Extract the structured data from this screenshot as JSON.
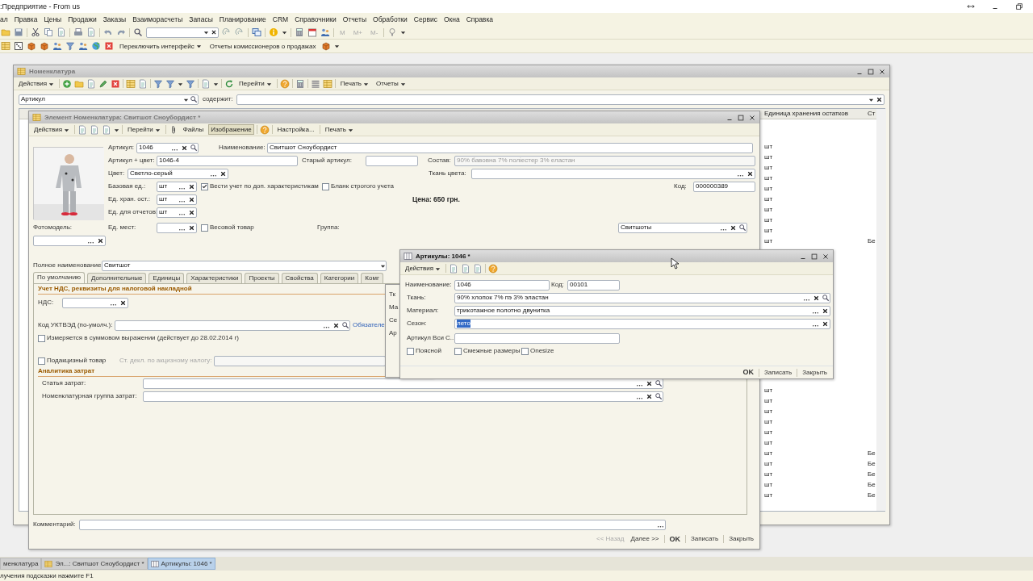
{
  "app": {
    "title": ":Предприятие - From us",
    "menu": [
      "ал",
      "Правка",
      "Цены",
      "Продажи",
      "Заказы",
      "Взаиморасчеты",
      "Запасы",
      "Планирование",
      "CRM",
      "Справочники",
      "Отчеты",
      "Обработки",
      "Сервис",
      "Окна",
      "Справка"
    ],
    "memory_buttons": [
      {
        "label": "M",
        "disabled": true
      },
      {
        "label": "M+",
        "disabled": true
      },
      {
        "label": "M-",
        "disabled": true
      }
    ],
    "toolbar2": [
      {
        "label": "Переключить интерфейс",
        "dropdown": true
      },
      {
        "label": "Отчеты комиссионеров о продажах",
        "dropdown": false
      }
    ]
  },
  "list_window": {
    "title": "Номенклатура",
    "active": false,
    "toolbar": [
      {
        "label": "Действия",
        "dropdown": true
      },
      {
        "label": "Перейти",
        "dropdown": true
      },
      {
        "label": "Печать",
        "dropdown": true
      },
      {
        "label": "Отчеты",
        "dropdown": true
      }
    ],
    "filter_field": {
      "value": "Артикул"
    },
    "filter_label": "содержит:",
    "columns": [
      "Единица хранения остатков",
      "Ст"
    ],
    "rows_top": [
      {
        "unit": "шт"
      },
      {
        "unit": "шт"
      },
      {
        "unit": "шт"
      },
      {
        "unit": "шт"
      },
      {
        "unit": "шт"
      },
      {
        "unit": "шт"
      },
      {
        "unit": "шт"
      },
      {
        "unit": "шт"
      },
      {
        "unit": "шт"
      },
      {
        "unit": "шт",
        "column_2": "Бе"
      }
    ],
    "rows_bottom": [
      {
        "unit": "шт"
      },
      {
        "unit": "шт"
      },
      {
        "unit": "шт"
      },
      {
        "unit": "шт"
      },
      {
        "unit": "шт"
      },
      {
        "unit": "шт"
      },
      {
        "unit": "шт",
        "column_2": "Бе"
      },
      {
        "unit": "шт",
        "column_2": "Бе"
      },
      {
        "unit": "шт",
        "column_2": "Бе"
      },
      {
        "unit": "шт",
        "column_2": "Бе"
      },
      {
        "unit": "шт",
        "column_2": "Бе"
      }
    ]
  },
  "element_window": {
    "title": "Элемент Номенклатура: Свитшот Сноубордист *",
    "active": false,
    "toolbar": [
      {
        "label": "Действия",
        "dropdown": true,
        "pressed": false
      },
      {
        "label": "Перейти",
        "dropdown": true,
        "pressed": false
      },
      {
        "label": "Файлы",
        "dropdown": false,
        "pressed": false
      },
      {
        "label": "Изображение",
        "dropdown": false,
        "pressed": true
      },
      {
        "label": "Настройка...",
        "dropdown": false,
        "pressed": false
      },
      {
        "label": "Печать",
        "dropdown": true,
        "pressed": false
      }
    ],
    "articul": {
      "label": "Артикул:",
      "value": "1046"
    },
    "name": {
      "label": "Наименование:",
      "value": "Свитшот Сноубордист"
    },
    "articul_color": {
      "label": "Артикул + цвет:",
      "value": "1046-4"
    },
    "old_articul": {
      "label": "Старый артикул:"
    },
    "composition": {
      "label": "Состав:",
      "value": "90% бавовна 7% поліестер 3% еластан",
      "disabled": true
    },
    "color": {
      "label": "Цвет:",
      "value": "Светло-серый"
    },
    "fabric_color": {
      "label": "Ткань цвета:"
    },
    "base_unit": {
      "label": "Базовая ед.:",
      "value": "шт"
    },
    "track_characteristics": {
      "label": "Вести учет по доп. характеристикам",
      "checked": true
    },
    "strict_form": {
      "label": "Бланк строгого учета",
      "checked": false
    },
    "code": {
      "label": "Код:",
      "value": "000000389"
    },
    "storage_unit": {
      "label": "Ед. хран. ост.:",
      "value": "шт"
    },
    "price": "Цена: 650 грн.",
    "report_unit": {
      "label": "Ед. для отчетов:",
      "value": "шт"
    },
    "photo_model": {
      "label": "Фотомодель:"
    },
    "place_unit": {
      "label": "Ед. мест:"
    },
    "weight_goods": {
      "label": "Весовой товар",
      "checked": false
    },
    "group": {
      "label": "Группа:",
      "value": "Свитшоты"
    },
    "full_name": {
      "label": "Полное наименование:",
      "value": "Свитшот"
    },
    "tabs": [
      {
        "label": "По умолчанию",
        "selected": true
      },
      {
        "label": "Дополнительные",
        "selected": false
      },
      {
        "label": "Единицы",
        "selected": false
      },
      {
        "label": "Характеристики",
        "selected": false
      },
      {
        "label": "Проекты",
        "selected": false
      },
      {
        "label": "Свойства",
        "selected": false
      },
      {
        "label": "Категории",
        "selected": false
      },
      {
        "label": "Комг",
        "selected": false
      }
    ],
    "vat_section": "Учет НДС, реквизиты для налоговой накладной",
    "vat": {
      "label": "НДС:"
    },
    "uktzed": {
      "label": "Код УКТВЭД (по-умолч.):",
      "link": "Обязателе"
    },
    "sum_measure": {
      "label": "Измеряется в суммовом выражении (действует до 28.02.2014 г)",
      "checked": false
    },
    "excise": {
      "label": "Подакцизный товар",
      "checked": false
    },
    "excise_declaration": {
      "label": "Ст. декл. по акцизному налогу:",
      "disabled": true
    },
    "cost_section": "Аналитика затрат",
    "cost_item": {
      "label": "Статья затрат:"
    },
    "cost_group": {
      "label": "Номенклатурная группа затрат:"
    },
    "comment": {
      "label": "Комментарий:"
    },
    "footer_buttons": [
      {
        "label": "<< Назад",
        "disabled": true,
        "default": false
      },
      {
        "label": "Далее >>",
        "disabled": false,
        "default": false
      },
      {
        "label": "OK",
        "disabled": false,
        "default": true
      },
      {
        "label": "Записать",
        "disabled": false,
        "default": false
      },
      {
        "label": "Закрыть",
        "disabled": false,
        "default": false
      }
    ]
  },
  "background_window": {
    "labels": [
      "Тк",
      "Ма",
      "Се",
      "Ар"
    ]
  },
  "dialog": {
    "title": "Артикулы: 1046 *",
    "active": true,
    "toolbar": [
      {
        "label": "Действия",
        "dropdown": true
      }
    ],
    "name": {
      "label": "Наименование:",
      "value": "1046"
    },
    "code": {
      "label": "Код:",
      "value": "00101"
    },
    "fabric": {
      "label": "Ткань:",
      "value": "90% хлопок 7% пэ 3% эластан"
    },
    "material": {
      "label": "Материал:",
      "value": "трикотажное полотно двунитка"
    },
    "season": {
      "label": "Сезон:",
      "value": "лето",
      "value_selected": true
    },
    "vsi_articul": {
      "label": "Артикул Вси С..."
    },
    "checkboxes": [
      {
        "label": "Поясной",
        "checked": false
      },
      {
        "label": "Смежные размеры",
        "checked": false
      },
      {
        "label": "Onesize",
        "checked": false
      }
    ],
    "footer_buttons": [
      {
        "label": "OK",
        "disabled": false,
        "default": true
      },
      {
        "label": "Записать",
        "disabled": false,
        "default": false
      },
      {
        "label": "Закрыть",
        "disabled": false,
        "default": false
      }
    ]
  },
  "taskbar": [
    {
      "label": "менклатура",
      "selected": false
    },
    {
      "label": "Эл...: Свитшот Сноубордист *",
      "selected": false
    },
    {
      "label": "Артикулы: 1046 *",
      "selected": true
    }
  ],
  "status_bar": "лучения подсказки нажмите F1"
}
